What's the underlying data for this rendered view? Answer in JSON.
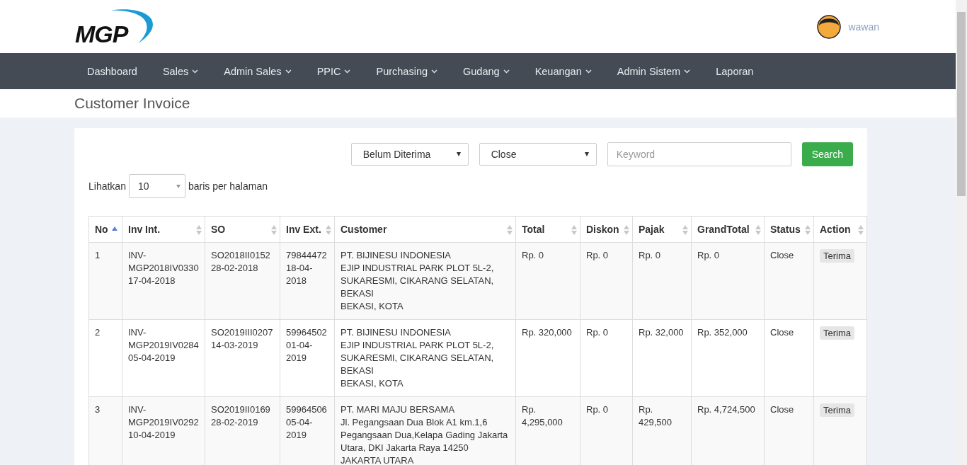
{
  "header": {
    "logo_text": "MGP",
    "user": {
      "name": "wawan"
    }
  },
  "nav": [
    {
      "label": "Dashboard",
      "dropdown": false
    },
    {
      "label": "Sales",
      "dropdown": true
    },
    {
      "label": "Admin Sales",
      "dropdown": true
    },
    {
      "label": "PPIC",
      "dropdown": true
    },
    {
      "label": "Purchasing",
      "dropdown": true
    },
    {
      "label": "Gudang",
      "dropdown": true
    },
    {
      "label": "Keuangan",
      "dropdown": true
    },
    {
      "label": "Admin Sistem",
      "dropdown": true
    },
    {
      "label": "Laporan",
      "dropdown": false
    }
  ],
  "page_title": "Customer Invoice",
  "filters": {
    "receive_status": "Belum Diterima",
    "status": "Close",
    "keyword_placeholder": "Keyword",
    "search_button": "Search"
  },
  "page_length": {
    "before": "Lihatkan",
    "value": "10",
    "after": "baris per halaman"
  },
  "table": {
    "columns": [
      {
        "label": "No",
        "sorted": true
      },
      {
        "label": "Inv Int.",
        "sorted": false
      },
      {
        "label": "SO",
        "sorted": false
      },
      {
        "label": "Inv Ext.",
        "sorted": false
      },
      {
        "label": "Customer",
        "sorted": false
      },
      {
        "label": "Total",
        "sorted": false
      },
      {
        "label": "Diskon",
        "sorted": false
      },
      {
        "label": "Pajak",
        "sorted": false
      },
      {
        "label": "GrandTotal",
        "sorted": false
      },
      {
        "label": "Status",
        "sorted": false
      },
      {
        "label": "Action",
        "sorted": false
      }
    ],
    "rows": [
      {
        "no": "1",
        "inv_int": "INV-MGP2018IV0330",
        "inv_int_date": "17-04-2018",
        "so": "SO2018II0152",
        "so_date": "28-02-2018",
        "inv_ext": "79844472",
        "inv_ext_date": "18-04-2018",
        "customer": [
          "PT. BIJINESU INDONESIA",
          "EJIP INDUSTRIAL PARK PLOT 5L-2, SUKARESMI, CIKARANG SELATAN, BEKASI",
          "BEKASI, KOTA"
        ],
        "total": "Rp. 0",
        "diskon": "Rp. 0",
        "pajak": "Rp. 0",
        "grand_total": "Rp. 0",
        "status": "Close",
        "action": "Terima"
      },
      {
        "no": "2",
        "inv_int": "INV-MGP2019IV0284",
        "inv_int_date": "05-04-2019",
        "so": "SO2019III0207",
        "so_date": "14-03-2019",
        "inv_ext": "59964502",
        "inv_ext_date": "01-04-2019",
        "customer": [
          "PT. BIJINESU INDONESIA",
          "EJIP INDUSTRIAL PARK PLOT 5L-2, SUKARESMI, CIKARANG SELATAN, BEKASI",
          "BEKASI, KOTA"
        ],
        "total": "Rp. 320,000",
        "diskon": "Rp. 0",
        "pajak": "Rp. 32,000",
        "grand_total": "Rp. 352,000",
        "status": "Close",
        "action": "Terima"
      },
      {
        "no": "3",
        "inv_int": "INV-MGP2019IV0292",
        "inv_int_date": "10-04-2019",
        "so": "SO2019II0169",
        "so_date": "28-02-2019",
        "inv_ext": "59964506",
        "inv_ext_date": "05-04-2019",
        "customer": [
          "PT. MARI MAJU BERSAMA",
          "Jl. Pegangsaan Dua Blok A1 km.1,6 Pegangsaan Dua,Kelapa Gading Jakarta Utara, DKI Jakarta Raya 14250",
          "JAKARTA UTARA"
        ],
        "total": "Rp. 4,295,000",
        "diskon": "Rp. 0",
        "pajak": "Rp. 429,500",
        "grand_total": "Rp. 4,724,500",
        "status": "Close",
        "action": "Terima"
      }
    ]
  }
}
